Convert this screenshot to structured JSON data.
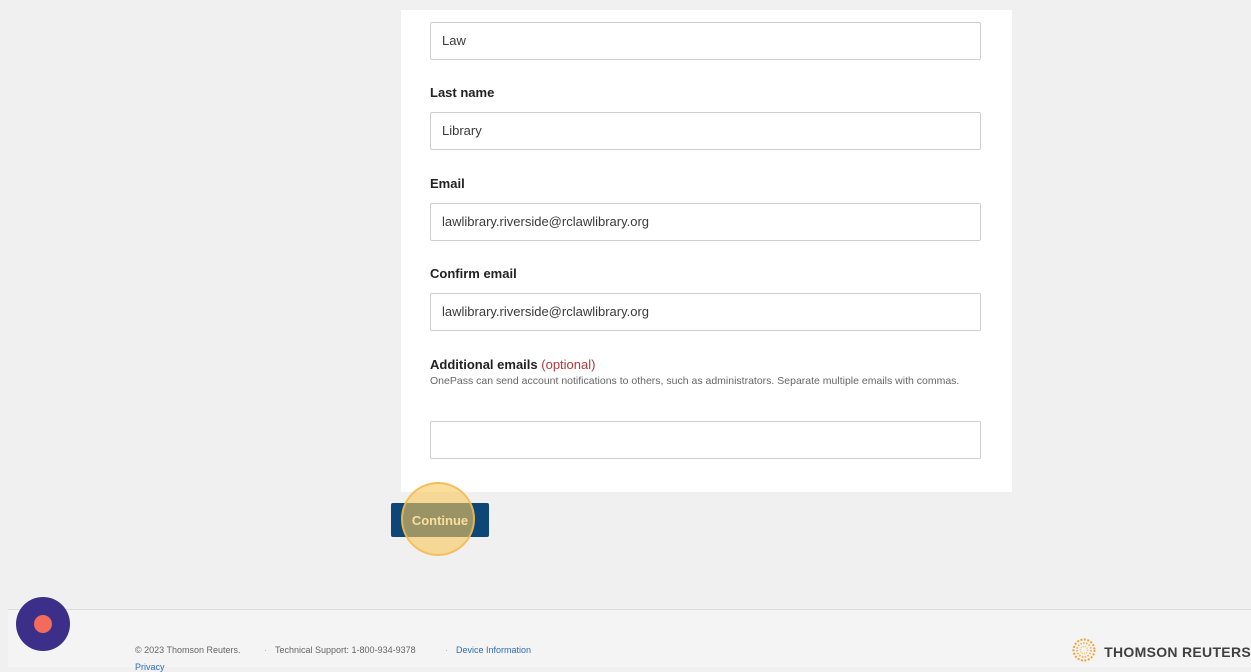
{
  "form": {
    "first_name_value": "Law",
    "last_name_label": "Last name",
    "last_name_value": "Library",
    "email_label": "Email",
    "email_value": "lawlibrary.riverside@rclawlibrary.org",
    "confirm_email_label": "Confirm email",
    "confirm_email_value": "lawlibrary.riverside@rclawlibrary.org",
    "additional_emails_label": "Additional emails",
    "additional_emails_optional": "(optional)",
    "additional_emails_help": "OnePass can send account notifications to others, such as administrators. Separate multiple emails with commas.",
    "additional_emails_value": ""
  },
  "actions": {
    "continue_label": "Continue"
  },
  "footer": {
    "copyright": "© 2023 Thomson Reuters.",
    "separator": "·",
    "support": "Technical Support: 1-800-934-9378",
    "device_info": "Device Information",
    "privacy": "Privacy",
    "brand": "THOMSON REUTERS"
  },
  "icons": {
    "brand_logo": "thomson-reuters-logo-icon",
    "record": "record-icon"
  },
  "colors": {
    "primary_button": "#0d4778",
    "optional_text": "#b03a3a",
    "link": "#2e6db4",
    "click_highlight": "#f8c65a",
    "record_button": "#3b2f8a",
    "record_dot": "#f26b5b"
  }
}
